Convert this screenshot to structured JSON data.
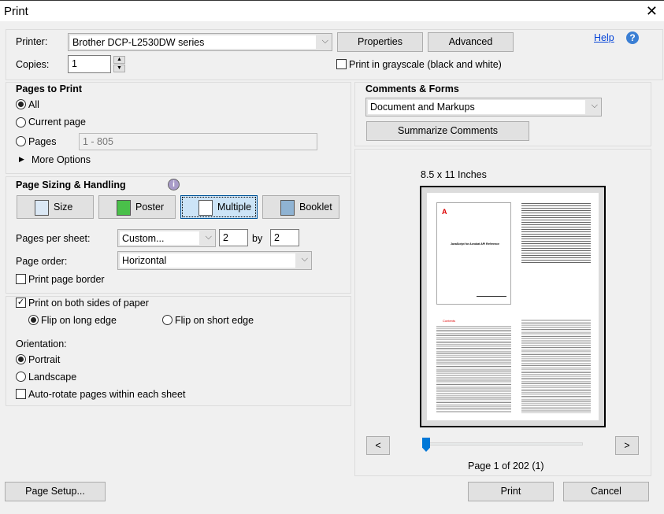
{
  "window": {
    "title": "Print",
    "close": "✕"
  },
  "top": {
    "printer_label": "Printer:",
    "printer_value": "Brother DCP-L2530DW series",
    "properties": "Properties",
    "advanced": "Advanced",
    "help": "Help",
    "copies_label": "Copies:",
    "copies_value": "1",
    "grayscale": "Print in grayscale (black and white)",
    "grayscale_checked": false
  },
  "pages_to_print": {
    "title": "Pages to Print",
    "all": "All",
    "current": "Current page",
    "pages": "Pages",
    "pages_placeholder": "1 - 805",
    "more": "More Options",
    "selected": "All"
  },
  "sizing": {
    "title": "Page Sizing & Handling",
    "tabs": [
      "Size",
      "Poster",
      "Multiple",
      "Booklet"
    ],
    "selected": "Multiple",
    "pps_label": "Pages per sheet:",
    "pps_value": "Custom...",
    "cols": "2",
    "by": "by",
    "rows": "2",
    "order_label": "Page order:",
    "order_value": "Horizontal",
    "border": "Print page border",
    "border_checked": false
  },
  "duplex": {
    "both_sides": "Print on both sides of paper",
    "both_checked": true,
    "long": "Flip on long edge",
    "short": "Flip on short edge",
    "flip_selected": "long",
    "orientation_label": "Orientation:",
    "portrait": "Portrait",
    "landscape": "Landscape",
    "orientation_selected": "Portrait",
    "autorotate": "Auto-rotate pages within each sheet",
    "autorotate_checked": false
  },
  "comments": {
    "title": "Comments & Forms",
    "value": "Document and Markups",
    "summarize": "Summarize Comments"
  },
  "preview": {
    "size": "8.5 x 11 Inches",
    "prev": "<",
    "next": ">",
    "page_status": "Page 1 of 202 (1)",
    "slider_position": 0.0,
    "cover_title": "JavaScript for Acrobat API Reference",
    "toc_heading": "Contents"
  },
  "footer": {
    "page_setup": "Page Setup...",
    "print": "Print",
    "cancel": "Cancel"
  }
}
